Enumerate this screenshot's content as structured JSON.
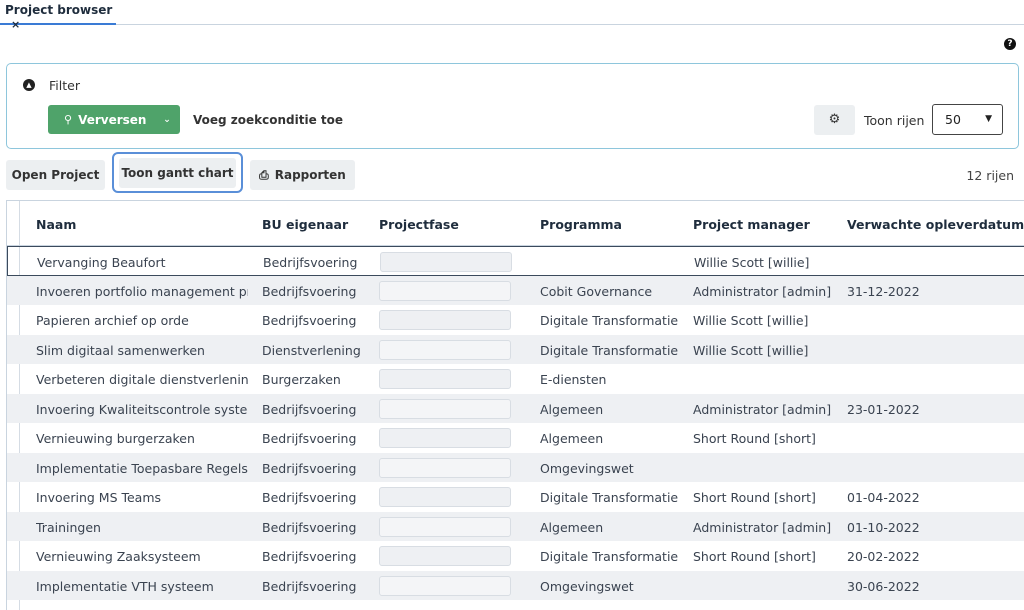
{
  "tab": {
    "title": "Project browser",
    "close": "×"
  },
  "help_icon": "?",
  "filter": {
    "toggle_icon": "chevron-up-icon",
    "title": "Filter",
    "refresh_label": "Verversen",
    "add_condition": "Voeg zoekconditie toe",
    "rows_label": "Toon rijen",
    "rows_value": "50"
  },
  "toolbar": {
    "open_project": "Open Project",
    "gantt": "Toon gantt chart",
    "reports": "Rapporten",
    "row_count": "12 rijen"
  },
  "table": {
    "headers": [
      "Naam",
      "BU eigenaar",
      "Projectfase",
      "Programma",
      "Project manager",
      "Verwachte opleverdatum"
    ],
    "rows": [
      {
        "naam": "Vervanging Beaufort",
        "bu": "Bedrijfsvoering",
        "programma": "",
        "pm": "Willie Scott [willie]",
        "datum": ""
      },
      {
        "naam": "Invoeren portfolio management proces",
        "bu": "Bedrijfsvoering",
        "programma": "Cobit Governance",
        "pm": "Administrator [admin]",
        "datum": "31-12-2022"
      },
      {
        "naam": "Papieren archief op orde",
        "bu": "Bedrijfsvoering",
        "programma": "Digitale Transformatie",
        "pm": "Willie Scott [willie]",
        "datum": ""
      },
      {
        "naam": "Slim digitaal samenwerken",
        "bu": "Dienstverlening",
        "programma": "Digitale Transformatie",
        "pm": "Willie Scott [willie]",
        "datum": ""
      },
      {
        "naam": "Verbeteren digitale dienstverlening burgers",
        "bu": "Burgerzaken",
        "programma": "E-diensten",
        "pm": "",
        "datum": ""
      },
      {
        "naam": "Invoering Kwaliteitscontrole systeem",
        "bu": "Bedrijfsvoering",
        "programma": "Algemeen",
        "pm": "Administrator [admin]",
        "datum": "23-01-2022"
      },
      {
        "naam": "Vernieuwing burgerzaken",
        "bu": "Bedrijfsvoering",
        "programma": "Algemeen",
        "pm": "Short Round [short]",
        "datum": ""
      },
      {
        "naam": "Implementatie Toepasbare Regels",
        "bu": "Bedrijfsvoering",
        "programma": "Omgevingswet",
        "pm": "",
        "datum": ""
      },
      {
        "naam": "Invoering MS Teams",
        "bu": "Bedrijfsvoering",
        "programma": "Digitale Transformatie",
        "pm": "Short Round [short]",
        "datum": "01-04-2022"
      },
      {
        "naam": "Trainingen",
        "bu": "Bedrijfsvoering",
        "programma": "Algemeen",
        "pm": "Administrator [admin]",
        "datum": "01-10-2022"
      },
      {
        "naam": "Vernieuwing Zaaksysteem",
        "bu": "Bedrijfsvoering",
        "programma": "Digitale Transformatie",
        "pm": "Short Round [short]",
        "datum": "20-02-2022"
      },
      {
        "naam": "Implementatie VTH systeem",
        "bu": "Bedrijfsvoering",
        "programma": "Omgevingswet",
        "pm": "",
        "datum": "30-06-2022"
      }
    ]
  },
  "colors": {
    "accent_green": "#4fa36a",
    "focus_blue": "#5a8fd8",
    "row_alt": "#eef0f3"
  }
}
